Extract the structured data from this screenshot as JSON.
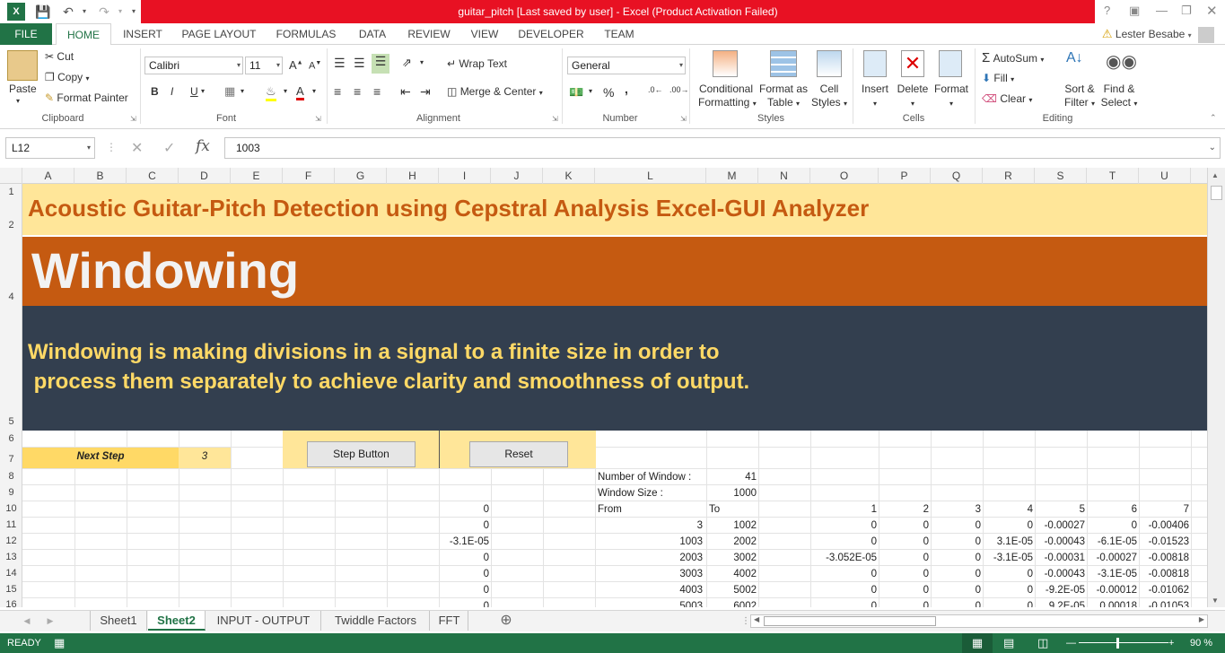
{
  "window": {
    "title": "guitar_pitch [Last saved by user] -  Excel (Product Activation Failed)",
    "user": "Lester Besabe",
    "help_icon": "?"
  },
  "tabs": [
    "FILE",
    "HOME",
    "INSERT",
    "PAGE LAYOUT",
    "FORMULAS",
    "DATA",
    "REVIEW",
    "VIEW",
    "DEVELOPER",
    "TEAM"
  ],
  "ribbon": {
    "clipboard": {
      "paste": "Paste",
      "cut": "Cut",
      "copy": "Copy",
      "format_painter": "Format Painter",
      "label": "Clipboard"
    },
    "font": {
      "name": "Calibri",
      "size": "11",
      "label": "Font",
      "bold": "B",
      "italic": "I",
      "underline": "U"
    },
    "alignment": {
      "wrap": "Wrap Text",
      "merge": "Merge & Center",
      "label": "Alignment"
    },
    "number": {
      "format": "General",
      "label": "Number",
      "percent": "%",
      "comma": ","
    },
    "styles": {
      "conditional": "Conditional",
      "conditional2": "Formatting",
      "format_as": "Format as",
      "format_as2": "Table",
      "cell": "Cell",
      "cell2": "Styles",
      "label": "Styles"
    },
    "cells": {
      "insert": "Insert",
      "delete": "Delete",
      "format": "Format",
      "label": "Cells"
    },
    "editing": {
      "autosum": "AutoSum",
      "fill": "Fill",
      "clear": "Clear",
      "sort": "Sort &",
      "sort2": "Filter",
      "find": "Find &",
      "find2": "Select",
      "label": "Editing"
    }
  },
  "formula_bar": {
    "name_box": "L12",
    "formula": "1003",
    "fx": "fx"
  },
  "columns": [
    "A",
    "B",
    "C",
    "D",
    "E",
    "F",
    "G",
    "H",
    "I",
    "J",
    "K",
    "L",
    "M",
    "N",
    "O",
    "P",
    "Q",
    "R",
    "S",
    "T",
    "U"
  ],
  "rows": [
    "1",
    "2",
    "4",
    "5",
    "6",
    "7",
    "8",
    "9",
    "10",
    "11",
    "12",
    "13",
    "14",
    "15",
    "16"
  ],
  "sheet": {
    "banner_title": "Acoustic Guitar-Pitch Detection using Cepstral Analysis Excel-GUI Analyzer",
    "section_title": "Windowing",
    "desc_line1": "Windowing is making divisions in a signal to a finite size in order to",
    "desc_line2": " process them separately to achieve clarity and smoothness of output.",
    "next_step_label": "Next Step",
    "next_step_value": "3",
    "step_button": "Step Button",
    "reset_button": "Reset",
    "num_windows_label": "Number of Window :",
    "num_windows_value": "41",
    "window_size_label": "Window Size :",
    "window_size_value": "1000",
    "from_label": "From",
    "to_label": "To",
    "row10": {
      "I": "0",
      "O": "1",
      "P": "2",
      "Q": "3",
      "R": "4",
      "S": "5",
      "T": "6",
      "U": "7"
    },
    "data_rows": [
      {
        "I": "0",
        "L": "3",
        "M": "1002",
        "O": "0",
        "P": "0",
        "Q": "0",
        "R": "0",
        "S": "-0.00027",
        "T": "0",
        "U": "-0.00406"
      },
      {
        "I": "-3.1E-05",
        "L": "1003",
        "M": "2002",
        "O": "0",
        "P": "0",
        "Q": "0",
        "R": "3.1E-05",
        "S": "-0.00043",
        "T": "-6.1E-05",
        "U": "-0.01523"
      },
      {
        "I": "0",
        "L": "2003",
        "M": "3002",
        "O": "-3.052E-05",
        "P": "0",
        "Q": "0",
        "R": "-3.1E-05",
        "S": "-0.00031",
        "T": "-0.00027",
        "U": "-0.00818"
      },
      {
        "I": "0",
        "L": "3003",
        "M": "4002",
        "O": "0",
        "P": "0",
        "Q": "0",
        "R": "0",
        "S": "-0.00043",
        "T": "-3.1E-05",
        "U": "-0.00818"
      },
      {
        "I": "0",
        "L": "4003",
        "M": "5002",
        "O": "0",
        "P": "0",
        "Q": "0",
        "R": "0",
        "S": "-9.2E-05",
        "T": "-0.00012",
        "U": "-0.01062"
      },
      {
        "I": "0",
        "L": "5003",
        "M": "6002",
        "O": "0",
        "P": "0",
        "Q": "0",
        "R": "0",
        "S": "9.2E-05",
        "T": "0.00018",
        "U": "-0.01053"
      }
    ]
  },
  "sheet_tabs": [
    "Sheet1",
    "Sheet2",
    "INPUT - OUTPUT",
    "Twiddle Factors",
    "FFT"
  ],
  "status": {
    "ready": "READY",
    "zoom": "90 %"
  },
  "colors": {
    "excel_green": "#217346",
    "banner_yellow": "#ffe699",
    "orange": "#c55a11",
    "dark": "#333f4f",
    "gold_text": "#ffd966",
    "title_orange": "#c55a11"
  }
}
